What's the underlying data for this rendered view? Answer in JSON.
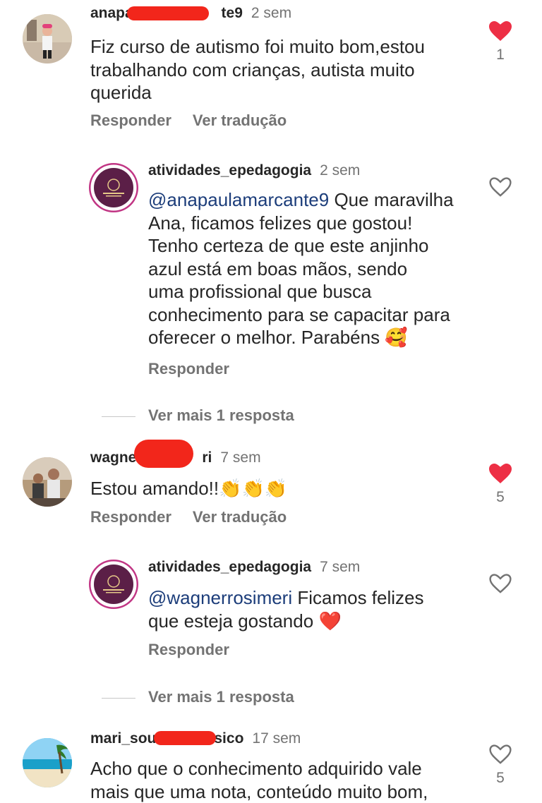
{
  "comments": [
    {
      "user": "anapau",
      "user_end": "te9",
      "time": "2 sem",
      "text": "Fiz curso de autismo foi muito bom,estou trabalhando com crianças, autista muito querida",
      "actions": [
        "Responder",
        "Ver tradução"
      ],
      "likes": "1",
      "liked": true
    },
    {
      "user": "wagne",
      "user_end": "ri",
      "time": "7 sem",
      "text": "Estou amando!!",
      "emoji": "👏👏👏",
      "actions": [
        "Responder",
        "Ver tradução"
      ],
      "likes": "5",
      "liked": true
    },
    {
      "user": "mari_sou",
      "user_end": "sico",
      "time": "17 sem",
      "text_line1": "Acho que o conhecimento adquirido vale",
      "text_line2": "mais que uma nota, conteúdo muito bom,",
      "likes": "5",
      "liked": false
    }
  ],
  "replies": [
    {
      "user": "atividades_epedagogia",
      "time": "2 sem",
      "mention": "@anapaulamarcante9",
      "lines": [
        " Que maravilha",
        "Ana, ficamos felizes que gostou!",
        "Tenho certeza de que este anjinho",
        "azul está em boas mãos, sendo",
        "uma profissional que busca",
        "conhecimento para se capacitar para",
        "oferecer o melhor. Parabéns"
      ],
      "emoji": "🥰",
      "action": "Responder",
      "more": "Ver mais 1 resposta"
    },
    {
      "user": "atividades_epedagogia",
      "time": "7 sem",
      "mention": "@wagnerrosimeri",
      "lines": [
        " Ficamos felizes",
        "que esteja gostando"
      ],
      "emoji": "❤️",
      "action": "Responder",
      "more": "Ver mais 1 resposta"
    }
  ],
  "colors": {
    "heart_filled": "#ed2f45",
    "mention": "#1c3d7a",
    "meta": "#737373",
    "redaction": "#f2261b"
  },
  "icons": {
    "like": "heart-icon",
    "like_outline": "heart-outline-icon"
  }
}
